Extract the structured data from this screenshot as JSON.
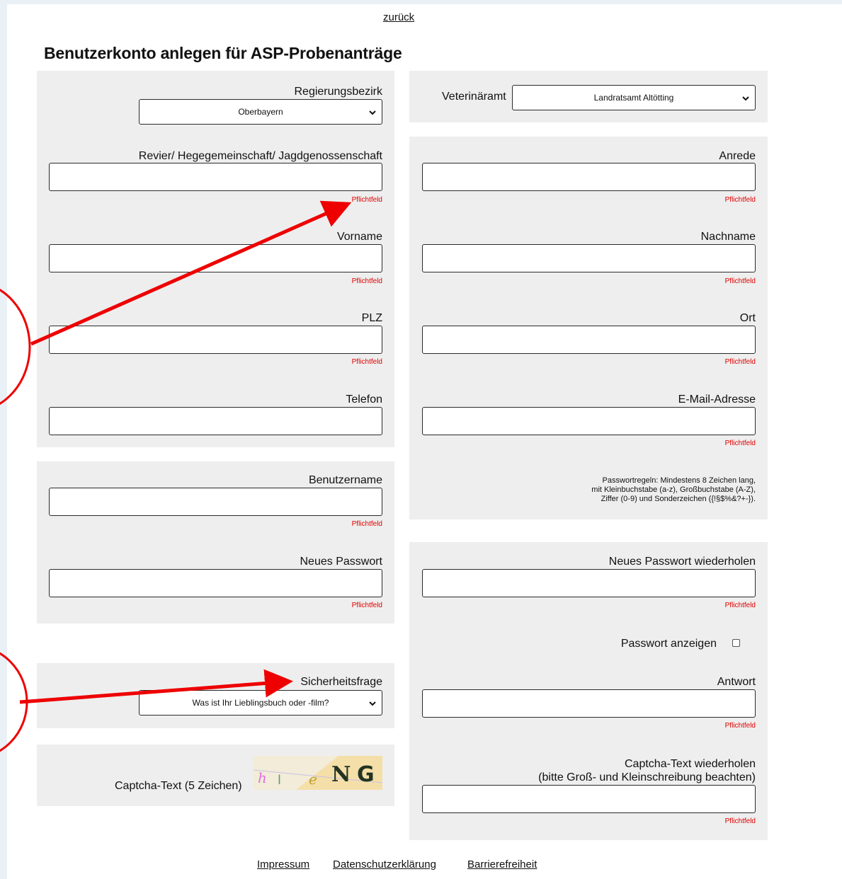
{
  "nav": {
    "back": "zurück"
  },
  "page_title": "Benutzerkonto anlegen für ASP-Probenanträge",
  "required_text": "Pflichtfeld",
  "fields": {
    "regierungsbezirk": {
      "label": "Regierungsbezirk",
      "value": "Oberbayern"
    },
    "veterinaeramt": {
      "label": "Veterinäramt",
      "value": "Landratsamt Altötting"
    },
    "revier": {
      "label": "Revier/ Hegegemeinschaft/ Jagdgenossenschaft"
    },
    "anrede": {
      "label": "Anrede"
    },
    "vorname": {
      "label": "Vorname"
    },
    "nachname": {
      "label": "Nachname"
    },
    "plz": {
      "label": "PLZ"
    },
    "ort": {
      "label": "Ort"
    },
    "telefon": {
      "label": "Telefon"
    },
    "email": {
      "label": "E-Mail-Adresse"
    },
    "benutzername": {
      "label": "Benutzername"
    },
    "neues_passwort": {
      "label": "Neues Passwort"
    },
    "passwort_wiederholen": {
      "label": "Neues Passwort wiederholen"
    },
    "passwort_anzeigen": {
      "label": "Passwort anzeigen"
    },
    "sicherheitsfrage": {
      "label": "Sicherheitsfrage",
      "value": "Was ist Ihr Lieblingsbuch oder -film?"
    },
    "antwort": {
      "label": "Antwort"
    },
    "captcha": {
      "label": "Captcha-Text (5 Zeichen)",
      "image_text": "hleNG"
    },
    "captcha_wiederholen": {
      "label_line1": "Captcha-Text wiederholen",
      "label_line2": "(bitte Groß- und Kleinschreibung beachten)"
    }
  },
  "password_rules": {
    "line1": "Passwortregeln: Mindestens 8 Zeichen lang,",
    "line2": "mit Kleinbuchstabe (a-z), Großbuchstabe (A-Z),",
    "line3": "Ziffer (0-9) und Sonderzeichen ({!§$%&?+-})."
  },
  "footer": {
    "impressum": "Impressum",
    "datenschutz": "Datenschutzerklärung",
    "barrierefreiheit": "Barrierefreiheit"
  },
  "colors": {
    "panel": "#eeeeee",
    "required": "#e00000",
    "annotation": "#ee0000"
  },
  "icons": {
    "select_arrow": "chevron-down-icon",
    "annotation_arrow": "arrow-icon",
    "annotation_circle": "circle-icon"
  }
}
